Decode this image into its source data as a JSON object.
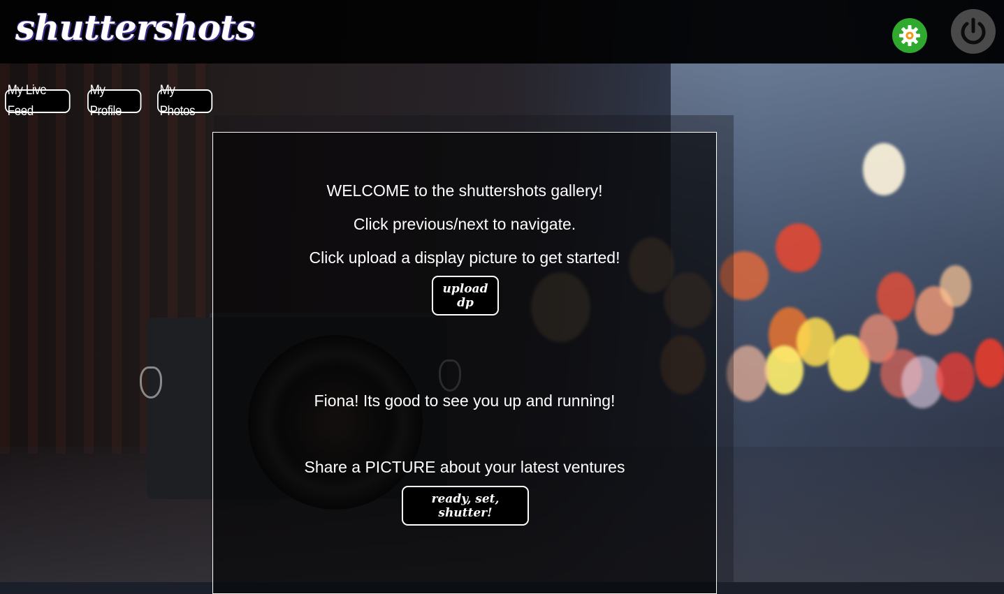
{
  "app": {
    "logo_text": "shuttershots"
  },
  "header": {
    "settings_icon": "gear-icon",
    "power_icon": "power-icon",
    "settings_color": "#2faa2f",
    "power_color": "#4a4a4a"
  },
  "nav": {
    "items": [
      {
        "label": "My Live Feed"
      },
      {
        "label": "My Profile"
      },
      {
        "label": "My Photos"
      }
    ]
  },
  "main": {
    "welcome": "WELCOME to the shuttershots gallery!",
    "navigate_hint": "Click previous/next to navigate.",
    "upload_hint": "Click upload a display picture to get started!",
    "upload_button": "upload dp",
    "greeting": "Fiona! Its good to see you up and running!",
    "share_prompt": "Share a PICTURE about your latest ventures",
    "shutter_button": "ready, set, shutter!"
  }
}
